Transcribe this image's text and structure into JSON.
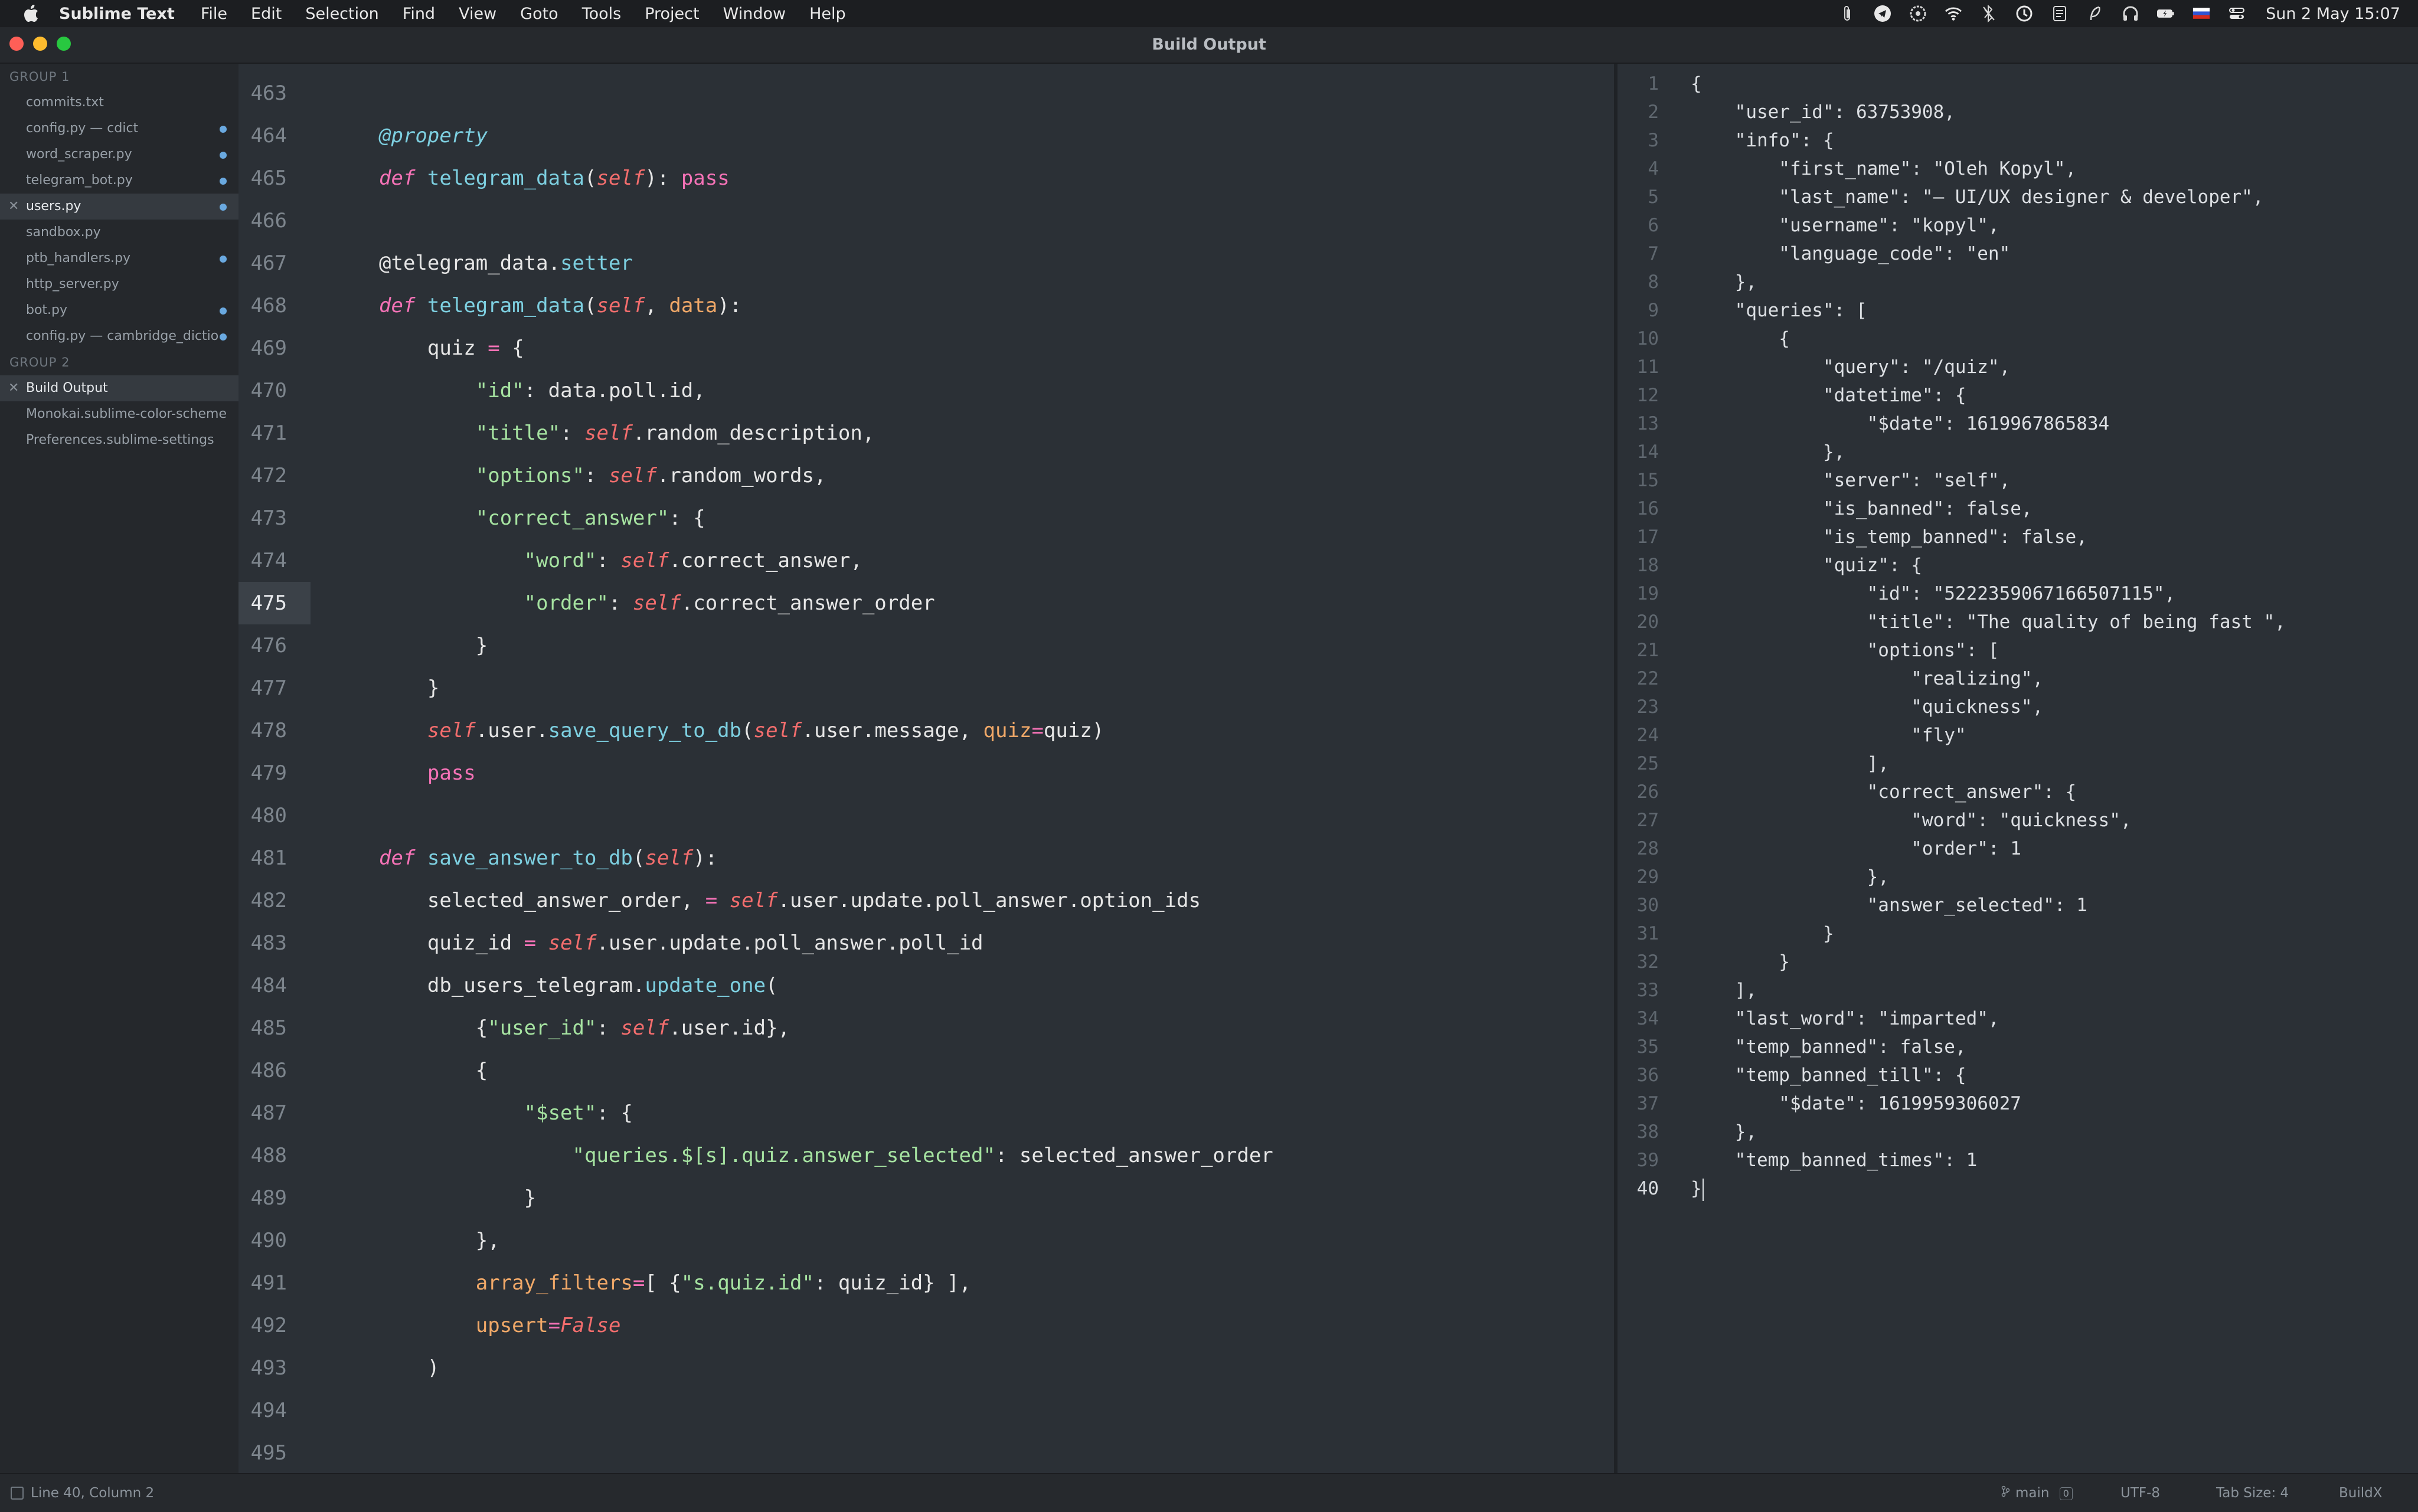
{
  "menubar": {
    "app_name": "Sublime Text",
    "items": [
      "File",
      "Edit",
      "Selection",
      "Find",
      "View",
      "Goto",
      "Tools",
      "Project",
      "Window",
      "Help"
    ],
    "clock": "Sun 2 May  15:07"
  },
  "window": {
    "title": "Build Output"
  },
  "sidebar": {
    "group1_label": "GROUP 1",
    "group1_files": [
      {
        "name": "commits.txt",
        "dirty": false,
        "active": false
      },
      {
        "name": "config.py — cdict",
        "dirty": true,
        "active": false
      },
      {
        "name": "word_scraper.py",
        "dirty": true,
        "active": false
      },
      {
        "name": "telegram_bot.py",
        "dirty": true,
        "active": false
      },
      {
        "name": "users.py",
        "dirty": true,
        "active": true
      },
      {
        "name": "sandbox.py",
        "dirty": false,
        "active": false
      },
      {
        "name": "ptb_handlers.py",
        "dirty": true,
        "active": false
      },
      {
        "name": "http_server.py",
        "dirty": false,
        "active": false
      },
      {
        "name": "bot.py",
        "dirty": true,
        "active": false
      },
      {
        "name": "config.py — cambridge_dictio",
        "dirty": true,
        "active": false
      }
    ],
    "group2_label": "GROUP 2",
    "group2_files": [
      {
        "name": "Build Output",
        "dirty": false,
        "active": true
      },
      {
        "name": "Monokai.sublime-color-scheme",
        "dirty": false,
        "active": false
      },
      {
        "name": "Preferences.sublime-settings",
        "dirty": false,
        "active": false
      }
    ]
  },
  "left_editor": {
    "current_line": 475,
    "lines": [
      {
        "n": "463",
        "code": ""
      },
      {
        "n": "464",
        "code": "@property"
      },
      {
        "n": "465",
        "code": "def telegram_data(self): pass"
      },
      {
        "n": "466",
        "code": ""
      },
      {
        "n": "467",
        "code": "@telegram_data.setter"
      },
      {
        "n": "468",
        "code": "def telegram_data(self, data):"
      },
      {
        "n": "469",
        "code": "    quiz = {"
      },
      {
        "n": "470",
        "code": "        \"id\": data.poll.id,"
      },
      {
        "n": "471",
        "code": "        \"title\": self.random_description,"
      },
      {
        "n": "472",
        "code": "        \"options\": self.random_words,"
      },
      {
        "n": "473",
        "code": "        \"correct_answer\": {"
      },
      {
        "n": "474",
        "code": "            \"word\": self.correct_answer,"
      },
      {
        "n": "475",
        "code": "            \"order\": self.correct_answer_order"
      },
      {
        "n": "476",
        "code": "        }"
      },
      {
        "n": "477",
        "code": "    }"
      },
      {
        "n": "478",
        "code": "    self.user.save_query_to_db(self.user.message, quiz=quiz)"
      },
      {
        "n": "479",
        "code": "    pass"
      },
      {
        "n": "480",
        "code": ""
      },
      {
        "n": "481",
        "code": "def save_answer_to_db(self):"
      },
      {
        "n": "482",
        "code": "    selected_answer_order, = self.user.update.poll_answer.option_ids"
      },
      {
        "n": "483",
        "code": "    quiz_id = self.user.update.poll_answer.poll_id"
      },
      {
        "n": "484",
        "code": "    db_users_telegram.update_one("
      },
      {
        "n": "485",
        "code": "        {\"user_id\": self.user.id},"
      },
      {
        "n": "486",
        "code": "        {"
      },
      {
        "n": "487",
        "code": "            \"$set\": {"
      },
      {
        "n": "488",
        "code": "                \"queries.$[s].quiz.answer_selected\": selected_answer_order"
      },
      {
        "n": "489",
        "code": "            }"
      },
      {
        "n": "490",
        "code": "        },"
      },
      {
        "n": "491",
        "code": "        array_filters=[ {\"s.quiz.id\": quiz_id} ],"
      },
      {
        "n": "492",
        "code": "        upsert=False"
      },
      {
        "n": "493",
        "code": "    )"
      },
      {
        "n": "494",
        "code": ""
      },
      {
        "n": "495",
        "code": ""
      }
    ]
  },
  "right_editor": {
    "current_line": 40,
    "lines": [
      {
        "n": "1",
        "code": "{"
      },
      {
        "n": "2",
        "code": "    \"user_id\": 63753908,"
      },
      {
        "n": "3",
        "code": "    \"info\": {"
      },
      {
        "n": "4",
        "code": "        \"first_name\": \"Oleh Kopyl\","
      },
      {
        "n": "5",
        "code": "        \"last_name\": \"– UI/UX designer & developer\","
      },
      {
        "n": "6",
        "code": "        \"username\": \"kopyl\","
      },
      {
        "n": "7",
        "code": "        \"language_code\": \"en\""
      },
      {
        "n": "8",
        "code": "    },"
      },
      {
        "n": "9",
        "code": "    \"queries\": ["
      },
      {
        "n": "10",
        "code": "        {"
      },
      {
        "n": "11",
        "code": "            \"query\": \"/quiz\","
      },
      {
        "n": "12",
        "code": "            \"datetime\": {"
      },
      {
        "n": "13",
        "code": "                \"$date\": 1619967865834"
      },
      {
        "n": "14",
        "code": "            },"
      },
      {
        "n": "15",
        "code": "            \"server\": \"self\","
      },
      {
        "n": "16",
        "code": "            \"is_banned\": false,"
      },
      {
        "n": "17",
        "code": "            \"is_temp_banned\": false,"
      },
      {
        "n": "18",
        "code": "            \"quiz\": {"
      },
      {
        "n": "19",
        "code": "                \"id\": \"5222359067166507115\","
      },
      {
        "n": "20",
        "code": "                \"title\": \"The quality of being fast \","
      },
      {
        "n": "21",
        "code": "                \"options\": ["
      },
      {
        "n": "22",
        "code": "                    \"realizing\","
      },
      {
        "n": "23",
        "code": "                    \"quickness\","
      },
      {
        "n": "24",
        "code": "                    \"fly\""
      },
      {
        "n": "25",
        "code": "                ],"
      },
      {
        "n": "26",
        "code": "                \"correct_answer\": {"
      },
      {
        "n": "27",
        "code": "                    \"word\": \"quickness\","
      },
      {
        "n": "28",
        "code": "                    \"order\": 1"
      },
      {
        "n": "29",
        "code": "                },"
      },
      {
        "n": "30",
        "code": "                \"answer_selected\": 1"
      },
      {
        "n": "31",
        "code": "            }"
      },
      {
        "n": "32",
        "code": "        }"
      },
      {
        "n": "33",
        "code": "    ],"
      },
      {
        "n": "34",
        "code": "    \"last_word\": \"imparted\","
      },
      {
        "n": "35",
        "code": "    \"temp_banned\": false,"
      },
      {
        "n": "36",
        "code": "    \"temp_banned_till\": {"
      },
      {
        "n": "37",
        "code": "        \"$date\": 1619959306027"
      },
      {
        "n": "38",
        "code": "    },"
      },
      {
        "n": "39",
        "code": "    \"temp_banned_times\": 1"
      },
      {
        "n": "40",
        "code": "}"
      }
    ]
  },
  "statusbar": {
    "position": "Line 40, Column 2",
    "branch": "main",
    "branch_badge": "0",
    "encoding": "UTF-8",
    "tab_size": "Tab Size: 4",
    "build_system": "BuildX"
  },
  "colors": {
    "background": "#2b3036",
    "sidebar": "#25282c",
    "keyword": "#f472b6",
    "function": "#7dcfe0",
    "string": "#a6e3a1",
    "self": "#f26d6d",
    "param": "#f0a868",
    "dirty_dot": "#6aa9e0"
  }
}
